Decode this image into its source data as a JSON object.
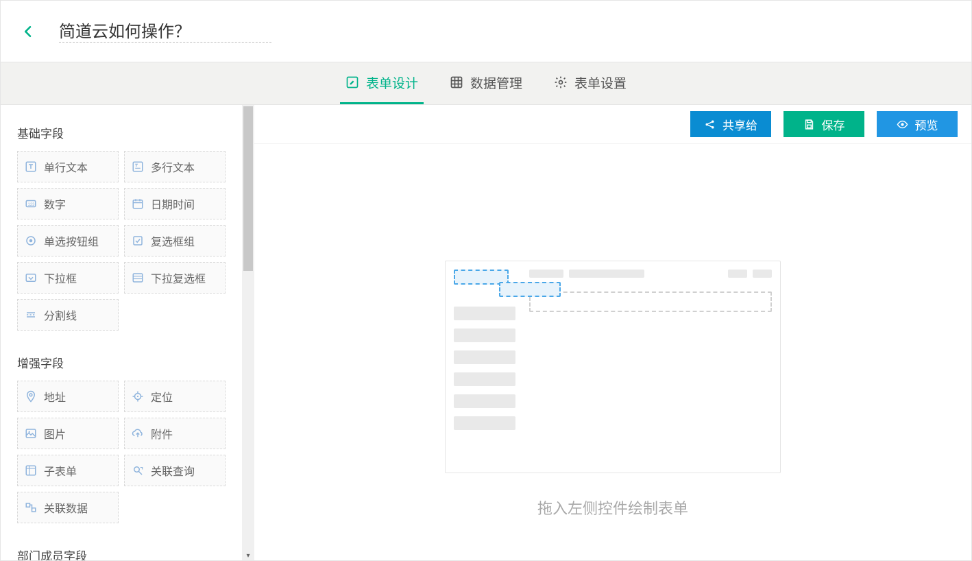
{
  "header": {
    "title": "简道云如何操作？"
  },
  "tabs": [
    {
      "id": "design",
      "label": "表单设计",
      "active": true
    },
    {
      "id": "data",
      "label": "数据管理",
      "active": false
    },
    {
      "id": "settings",
      "label": "表单设置",
      "active": false
    }
  ],
  "toolbar": {
    "share": "共享给",
    "save": "保存",
    "preview": "预览"
  },
  "sidebar": {
    "sections": [
      {
        "title": "基础字段",
        "fields": [
          {
            "id": "single-line-text",
            "label": "单行文本",
            "icon": "text"
          },
          {
            "id": "multi-line-text",
            "label": "多行文本",
            "icon": "textarea"
          },
          {
            "id": "number",
            "label": "数字",
            "icon": "number"
          },
          {
            "id": "datetime",
            "label": "日期时间",
            "icon": "calendar"
          },
          {
            "id": "radio-group",
            "label": "单选按钮组",
            "icon": "radio"
          },
          {
            "id": "checkbox-group",
            "label": "复选框组",
            "icon": "checkbox"
          },
          {
            "id": "select",
            "label": "下拉框",
            "icon": "select"
          },
          {
            "id": "multiselect",
            "label": "下拉复选框",
            "icon": "multiselect"
          },
          {
            "id": "divider",
            "label": "分割线",
            "icon": "divider",
            "single": true
          }
        ]
      },
      {
        "title": "增强字段",
        "fields": [
          {
            "id": "address",
            "label": "地址",
            "icon": "pin"
          },
          {
            "id": "location",
            "label": "定位",
            "icon": "target"
          },
          {
            "id": "image",
            "label": "图片",
            "icon": "image"
          },
          {
            "id": "attachment",
            "label": "附件",
            "icon": "cloud"
          },
          {
            "id": "subform",
            "label": "子表单",
            "icon": "subform"
          },
          {
            "id": "lookup",
            "label": "关联查询",
            "icon": "search-link"
          },
          {
            "id": "relation",
            "label": "关联数据",
            "icon": "relation",
            "single": true
          }
        ]
      },
      {
        "title": "部门成员字段",
        "fields": []
      }
    ]
  },
  "canvas": {
    "empty_text": "拖入左侧控件绘制表单"
  }
}
